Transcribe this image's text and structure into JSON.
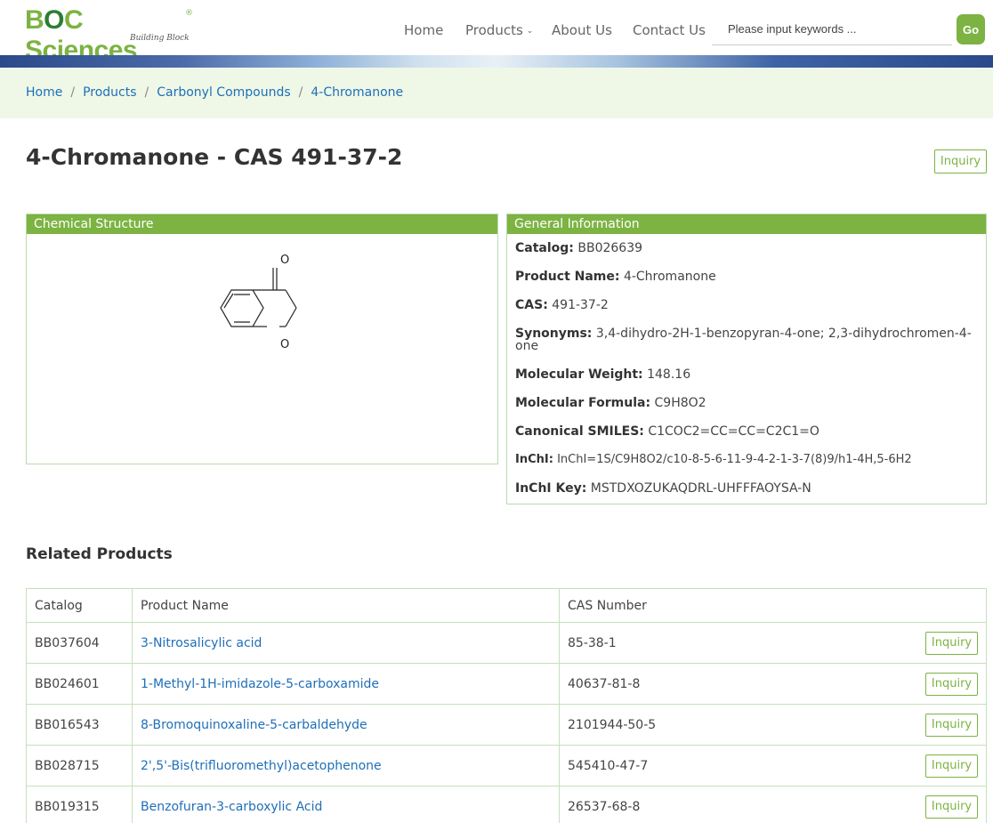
{
  "header": {
    "logo_main": "BOC Sciences",
    "logo_sub": "Building Block",
    "logo_reg": "®",
    "nav": {
      "home": "Home",
      "products": "Products",
      "about": "About Us",
      "contact": "Contact Us"
    },
    "search_placeholder": "Please input keywords ...",
    "go_label": "Go"
  },
  "breadcrumb": [
    "Home",
    "Products",
    "Carbonyl Compounds",
    "4-Chromanone"
  ],
  "breadcrumb_sep": "/",
  "page_title": "4-Chromanone - CAS 491-37-2",
  "inquiry_label": "Inquiry",
  "chemical_structure": {
    "heading": "Chemical Structure",
    "atom_labels": [
      "O",
      "O"
    ]
  },
  "general_info": {
    "heading": "General Information",
    "fields": [
      {
        "label": "Catalog:",
        "value": "BB026639"
      },
      {
        "label": "Product Name:",
        "value": "4-Chromanone"
      },
      {
        "label": "CAS:",
        "value": "491-37-2"
      },
      {
        "label": "Synonyms:",
        "value": "3,4-dihydro-2H-1-benzopyran-4-one; 2,3-dihydrochromen-4-one"
      },
      {
        "label": "Molecular Weight:",
        "value": "148.16"
      },
      {
        "label": "Molecular Formula:",
        "value": "C9H8O2"
      },
      {
        "label": "Canonical SMILES:",
        "value": "C1COC2=CC=CC=C2C1=O"
      },
      {
        "label": "InChI:",
        "value": "InChI=1S/C9H8O2/c10-8-5-6-11-9-4-2-1-3-7(8)9/h1-4H,5-6H2"
      },
      {
        "label": "InChI Key:",
        "value": "MSTDXOZUKAQDRL-UHFFFAOYSA-N"
      }
    ]
  },
  "related": {
    "heading": "Related Products",
    "columns": [
      "Catalog",
      "Product Name",
      "CAS Number"
    ],
    "rows": [
      {
        "catalog": "BB037604",
        "name": "3-Nitrosalicylic acid",
        "cas": "85-38-1"
      },
      {
        "catalog": "BB024601",
        "name": "1-Methyl-1H-imidazole-5-carboxamide",
        "cas": "40637-81-8"
      },
      {
        "catalog": "BB016543",
        "name": "8-Bromoquinoxaline-5-carbaldehyde",
        "cas": "2101944-50-5"
      },
      {
        "catalog": "BB028715",
        "name": "2',5'-Bis(trifluoromethyl)acetophenone",
        "cas": "545410-47-7"
      },
      {
        "catalog": "BB019315",
        "name": "Benzofuran-3-carboxylic Acid",
        "cas": "26537-68-8"
      }
    ]
  },
  "colors": {
    "brand_green": "#7cb342",
    "link_blue": "#1e6fb8",
    "crumb_bg": "#eff8e7"
  }
}
